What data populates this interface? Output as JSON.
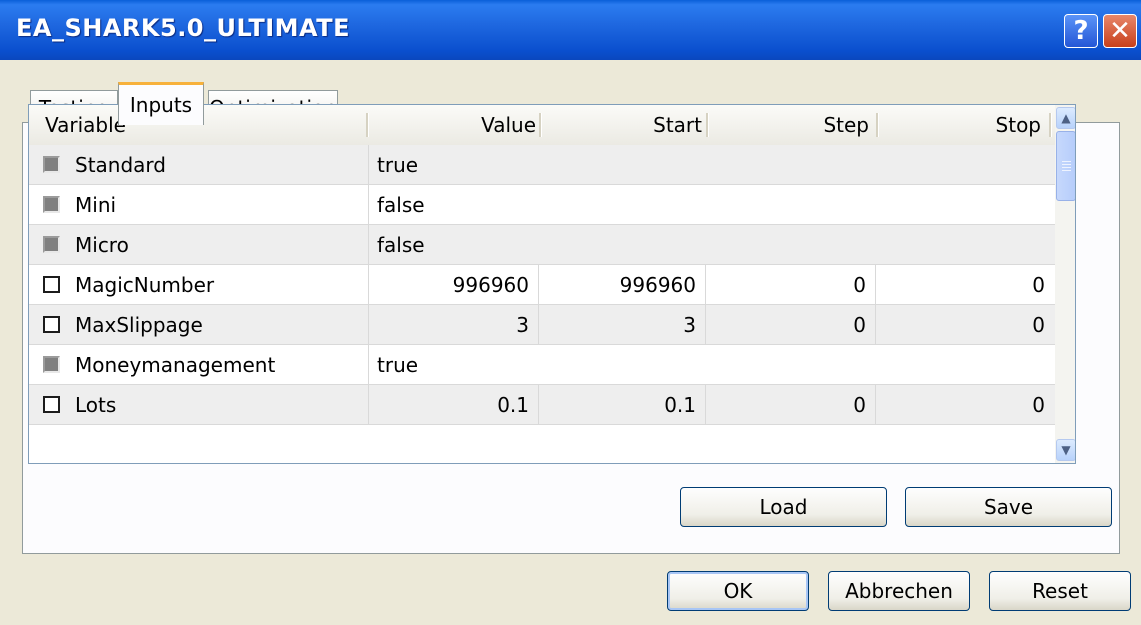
{
  "window": {
    "title": "EA_SHARK5.0_ULTIMATE",
    "help_glyph": "?",
    "close_glyph": "✕"
  },
  "tabs": [
    {
      "label": "Testing",
      "active": false
    },
    {
      "label": "Inputs",
      "active": true
    },
    {
      "label": "Optimization",
      "active": false
    }
  ],
  "grid": {
    "columns": [
      "Variable",
      "Value",
      "Start",
      "Step",
      "Stop"
    ],
    "rows": [
      {
        "name": "Standard",
        "value": "true",
        "start": "",
        "step": "",
        "stop": "",
        "numeric": false,
        "checkbox_enabled": false
      },
      {
        "name": "Mini",
        "value": "false",
        "start": "",
        "step": "",
        "stop": "",
        "numeric": false,
        "checkbox_enabled": false
      },
      {
        "name": "Micro",
        "value": "false",
        "start": "",
        "step": "",
        "stop": "",
        "numeric": false,
        "checkbox_enabled": false
      },
      {
        "name": "MagicNumber",
        "value": "996960",
        "start": "996960",
        "step": "0",
        "stop": "0",
        "numeric": true,
        "checkbox_enabled": true
      },
      {
        "name": "MaxSlippage",
        "value": "3",
        "start": "3",
        "step": "0",
        "stop": "0",
        "numeric": true,
        "checkbox_enabled": true
      },
      {
        "name": "Moneymanagement",
        "value": "true",
        "start": "",
        "step": "",
        "stop": "",
        "numeric": false,
        "checkbox_enabled": false
      },
      {
        "name": "Lots",
        "value": "0.1",
        "start": "0.1",
        "step": "0",
        "stop": "0",
        "numeric": true,
        "checkbox_enabled": true
      }
    ]
  },
  "panel_buttons": {
    "load": "Load",
    "save": "Save"
  },
  "dialog_buttons": {
    "ok": "OK",
    "cancel": "Abbrechen",
    "reset": "Reset"
  },
  "colors": {
    "title_bar": "#0a4fce",
    "tab_highlight": "#f7b13b",
    "dialog_bg": "#ece9d8"
  }
}
